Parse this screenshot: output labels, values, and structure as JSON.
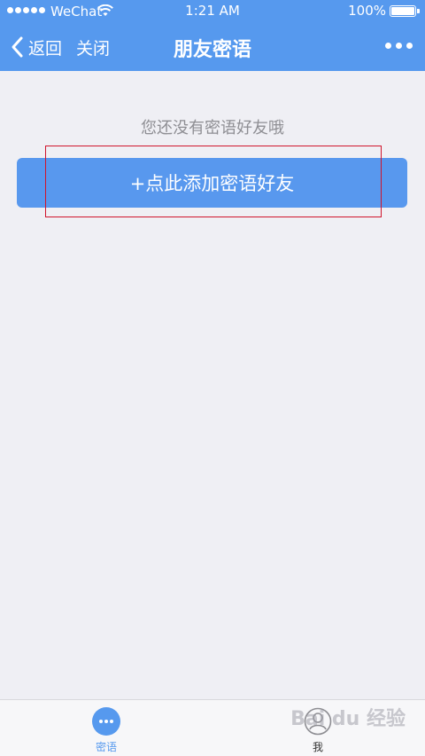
{
  "status_bar": {
    "carrier": "WeChat",
    "time": "1:21 AM",
    "battery": "100%"
  },
  "nav": {
    "back_label": "返回",
    "close_label": "关闭",
    "title": "朋友密语"
  },
  "content": {
    "empty_message": "您还没有密语好友哦",
    "add_button_label": "+点此添加密语好友"
  },
  "tabbar": {
    "tabs": [
      {
        "label": "密语",
        "icon": "chat-bubble-icon",
        "active": true
      },
      {
        "label": "我",
        "icon": "person-icon",
        "active": false
      }
    ]
  },
  "watermark": "Bai du 经验",
  "colors": {
    "primary": "#5699ee",
    "background": "#efeff4",
    "highlight": "#d0142c",
    "muted_text": "#8e8e93"
  }
}
